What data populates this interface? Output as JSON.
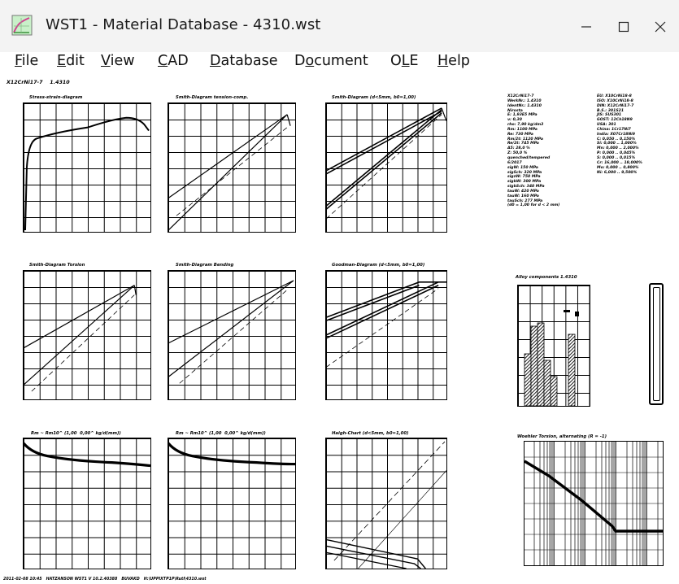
{
  "window": {
    "title": "WST1  -  Material Database  -  4310.wst",
    "minimize_icon": "minimize-icon",
    "maximize_icon": "maximize-icon",
    "close_icon": "close-icon"
  },
  "menu": {
    "items": [
      {
        "label": "File",
        "accel": "F",
        "rest": "ile"
      },
      {
        "label": "Edit",
        "accel": "E",
        "rest": "dit"
      },
      {
        "label": "View",
        "accel": "V",
        "rest": "iew"
      },
      {
        "label": "CAD",
        "accel": "C",
        "rest": "AD"
      },
      {
        "label": "Database",
        "accel": "D",
        "rest": "atabase"
      },
      {
        "label": "Document",
        "accel": "o",
        "pre": "D",
        "rest": "cument"
      },
      {
        "label": "OLE",
        "accel": "L",
        "pre": "O",
        "rest": "E"
      },
      {
        "label": "Help",
        "accel": "H",
        "rest": "elp"
      }
    ]
  },
  "document": {
    "heading": "X12CrNi17-7    1.4310",
    "footer": "2011-02-08 10:45   HATZANSON WST1 V 10.2.40388   BUVAKD   H:\\UPPIXTP1P\\Rutl\\4310.wst",
    "charts": {
      "c1_title": "Stress-strain-diagram",
      "c2_title": "Smith-Diagram tension-comp.",
      "c3_title": "Smith-Diagram (d<5mm, b0=1,00)",
      "c4_title": "Smith-Diagram Torsion",
      "c5_title": "Smith-Diagram Bending",
      "c6_title": "Goodman-Diagram (d<5mm, b0=1,00)",
      "c7_title": "Rm ~ Rm10^ (1,00  0,00^ kg/d(mm))",
      "c8_title": "Rm ~ Rm10^ (1,00  0,00^ kg/d(mm))",
      "c9_title": "Haigh-Chart (d<5mm, b0=1,00)",
      "c10_title": "Alloy components 1.4310",
      "c11_title": "Woehler Torsion, alternating (R = -1)"
    },
    "props_left": "X12CrNi17-7\nWerkNr.: 1.4310\nIdentNr.: 1.4310\nNirosta\nE: 1,93E5 MPa\nν: 0,30\nrho: 7,90 kg/dm3\nRm: 1100 MPa\nRe: 730 MPa\nRm/2t: 1120 MPa\nRe/2t: 745 MPa\nA5: 28,0 %\nZ: 50,0 %\nquenched/tempered\n6/2017\nsigW: 150 MPa\nsigSch: 320 MPa\nsigzW: 750 MPa\nsigbW: 300 MPa\nsigbSch: 340 MPa\ntauW: 420 MPa\ntauW: 160 MPa\ntauSch: 277 MPa\n(d0 = 1,00 for d < 2 mm)",
    "props_right": "EU: X10CrNi18-8\nISO: X10CrNi18-8\nDIN: X12CrNi17-7\nB.S.: 301S21\nJIS: SUS301\nGOST: 12Ch18N9\nUSA: 301\nChina: 1Cr17Ni7\nIndia: X07Cr18Ni9\nC: 0,050 .. 0,150%\nSi: 0,000 .. 1,000%\nMn: 0,000 .. 2,000%\nP: 0,000 .. 0,045%\nS: 0,000 .. 0,015%\nCr: 16,000 .. 18,000%\nMo: 0,000 .. 0,800%\nNi: 6,000 .. 9,500%"
  },
  "colors": {
    "titlebar": "#f3f3f3",
    "ink": "#000000"
  }
}
